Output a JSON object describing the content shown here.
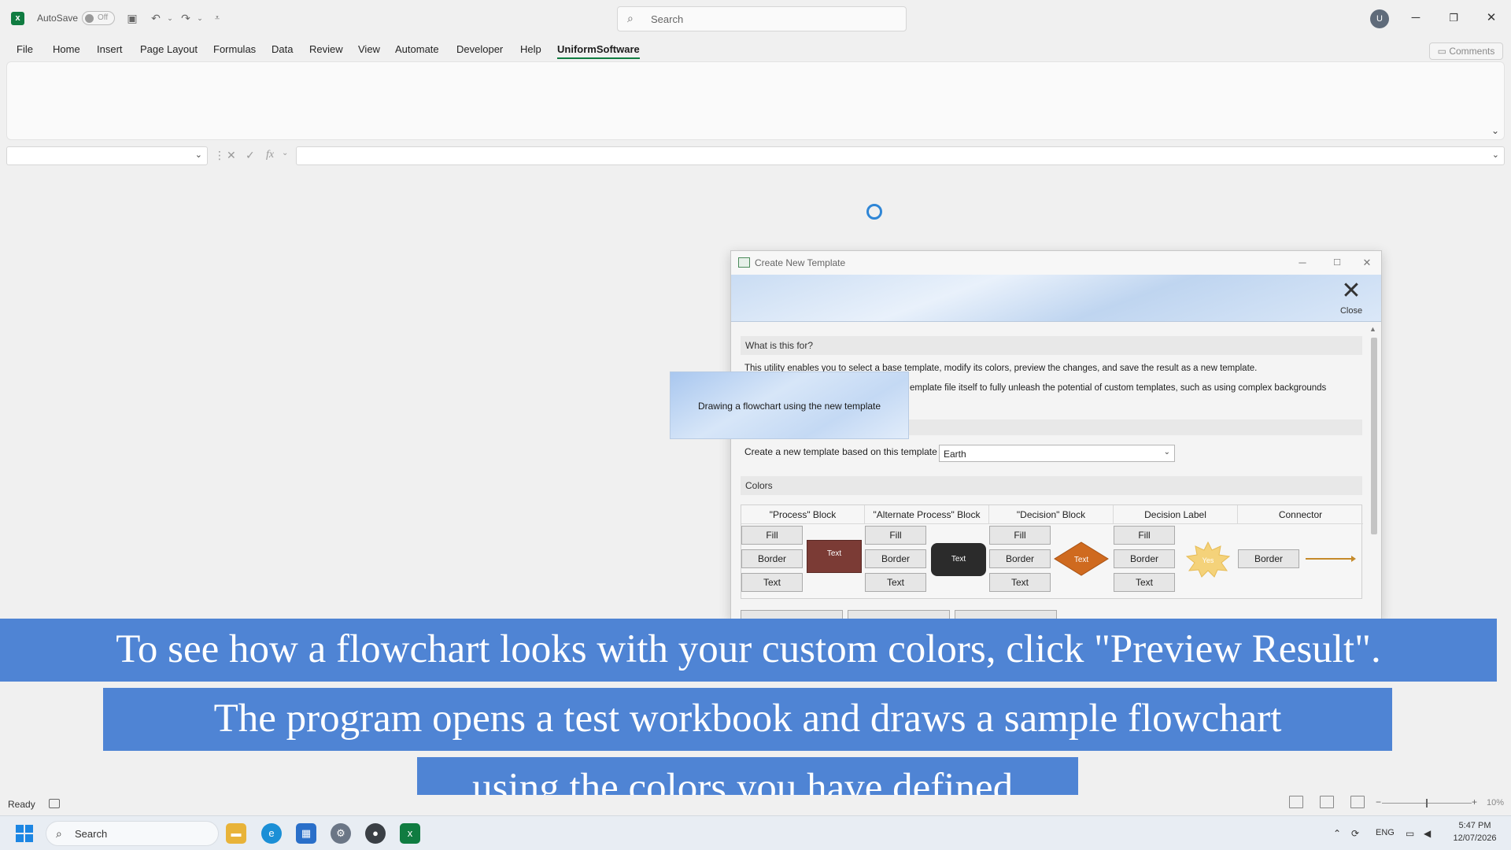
{
  "titlebar": {
    "autosave_label": "AutoSave",
    "toggle_state": "Off",
    "search_placeholder": "Search",
    "avatar_initial": "U"
  },
  "ribbon": {
    "tabs": [
      "File",
      "Home",
      "Insert",
      "Page Layout",
      "Formulas",
      "Data",
      "Review",
      "View",
      "Automate",
      "Developer",
      "Help",
      "UniformSoftware"
    ],
    "active_tab": "UniformSoftware",
    "comments_label": "Comments"
  },
  "dialog": {
    "title": "Create New Template",
    "close_label": "Close",
    "section_what": "What is this for?",
    "para1": "This utility enables you to select a base template, modify its colors, preview the changes, and save the result as a new template.",
    "para2": "emplate file itself to fully unleash the potential of custom templates, such as using complex backgrounds",
    "template_label": "Create a new template based on this template",
    "template_value": "Earth",
    "section_colors": "Colors",
    "columns": {
      "process": "\"Process\" Block",
      "alternate": "\"Alternate Process\" Block",
      "decision": "\"Decision\" Block",
      "decision_label": "Decision Label",
      "connector": "Connector"
    },
    "btn_fill": "Fill",
    "btn_border": "Border",
    "btn_text": "Text",
    "swatch_text": "Text",
    "decision_label_text": "Yes"
  },
  "tooltip": {
    "text": "Drawing a flowchart using the new template"
  },
  "captions": {
    "line1": "To see how a flowchart looks with your custom colors, click \"Preview Result\".",
    "line2": "The program opens a test workbook and draws a sample flowchart",
    "line3": "using the colors you have defined."
  },
  "statusbar": {
    "ready": "Ready",
    "zoom": "10%"
  },
  "taskbar": {
    "search_placeholder": "Search",
    "lang": "ENG",
    "time": "5:47 PM",
    "date": "12/07/2026"
  },
  "colors": {
    "excel_green": "#107c41",
    "caption_bg": "#4f84d4",
    "process_fill": "#7b3b35",
    "alternate_fill": "#2b2b2b",
    "decision_fill": "#cf6a1f",
    "label_fill": "#f4d27a",
    "connector": "#c58a2a"
  }
}
